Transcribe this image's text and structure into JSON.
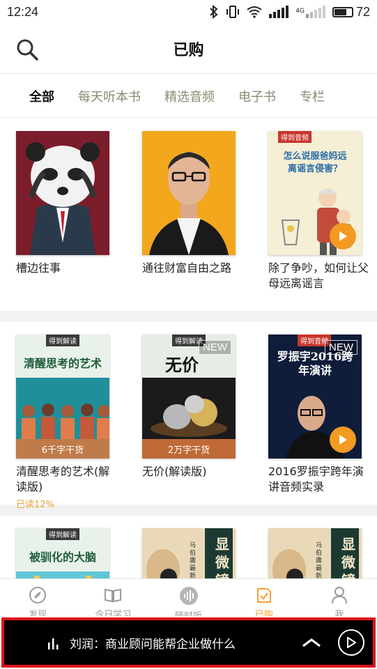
{
  "status_bar": {
    "time": "12:24",
    "network": "4G",
    "battery": "72",
    "battery_level": 0.72
  },
  "header": {
    "title": "已购"
  },
  "tabs": [
    {
      "label": "全部",
      "active": true
    },
    {
      "label": "每天听本书",
      "active": false
    },
    {
      "label": "精选音频",
      "active": false
    },
    {
      "label": "电子书",
      "active": false
    },
    {
      "label": "专栏",
      "active": false
    }
  ],
  "rows": [
    [
      {
        "title": "槽边往事"
      },
      {
        "title": "通往财富自由之路"
      },
      {
        "title": "除了争吵，如何让父母远离谣言",
        "tag": "得到音频",
        "cover_text": "怎么说服爸妈远离谣言侵害？"
      }
    ],
    [
      {
        "title": "清醒思考的艺术(解读版)",
        "tag": "得到解读",
        "cover_text": "清醒思考的艺术",
        "strip": "6千字干货",
        "progress": "已读12%"
      },
      {
        "title": "无价(解读版)",
        "tag": "得到解读",
        "cover_text": "无价",
        "strip": "2万字干货",
        "badge": "NEW"
      },
      {
        "title": "2016罗振宇跨年演讲音频实录",
        "tag": "得到音频",
        "cover_text": "罗振宇2016跨年演讲",
        "badge": "NEW"
      }
    ],
    [
      {
        "tag": "得到解读",
        "cover_text": "被驯化的大脑"
      },
      {
        "cover_text": "显微镜下",
        "author": "马伯庸 最新力作"
      },
      {
        "cover_text": "显微镜下",
        "author": "马伯庸 最新力作"
      }
    ]
  ],
  "bottom_nav": [
    {
      "label": "发现",
      "icon": "compass-icon",
      "active": false
    },
    {
      "label": "今日学习",
      "icon": "book-icon",
      "active": false
    },
    {
      "label": "随时听",
      "icon": "audio-wave-icon",
      "active": false
    },
    {
      "label": "已购",
      "icon": "purchased-icon",
      "active": true
    },
    {
      "label": "我",
      "icon": "person-icon",
      "active": false
    }
  ],
  "player": {
    "now_playing": "刘润：商业顾问能帮企业做什么"
  },
  "colors": {
    "accent": "#f2a135",
    "highlight_border": "#e0121b",
    "tab_inactive": "#8a8a70"
  }
}
